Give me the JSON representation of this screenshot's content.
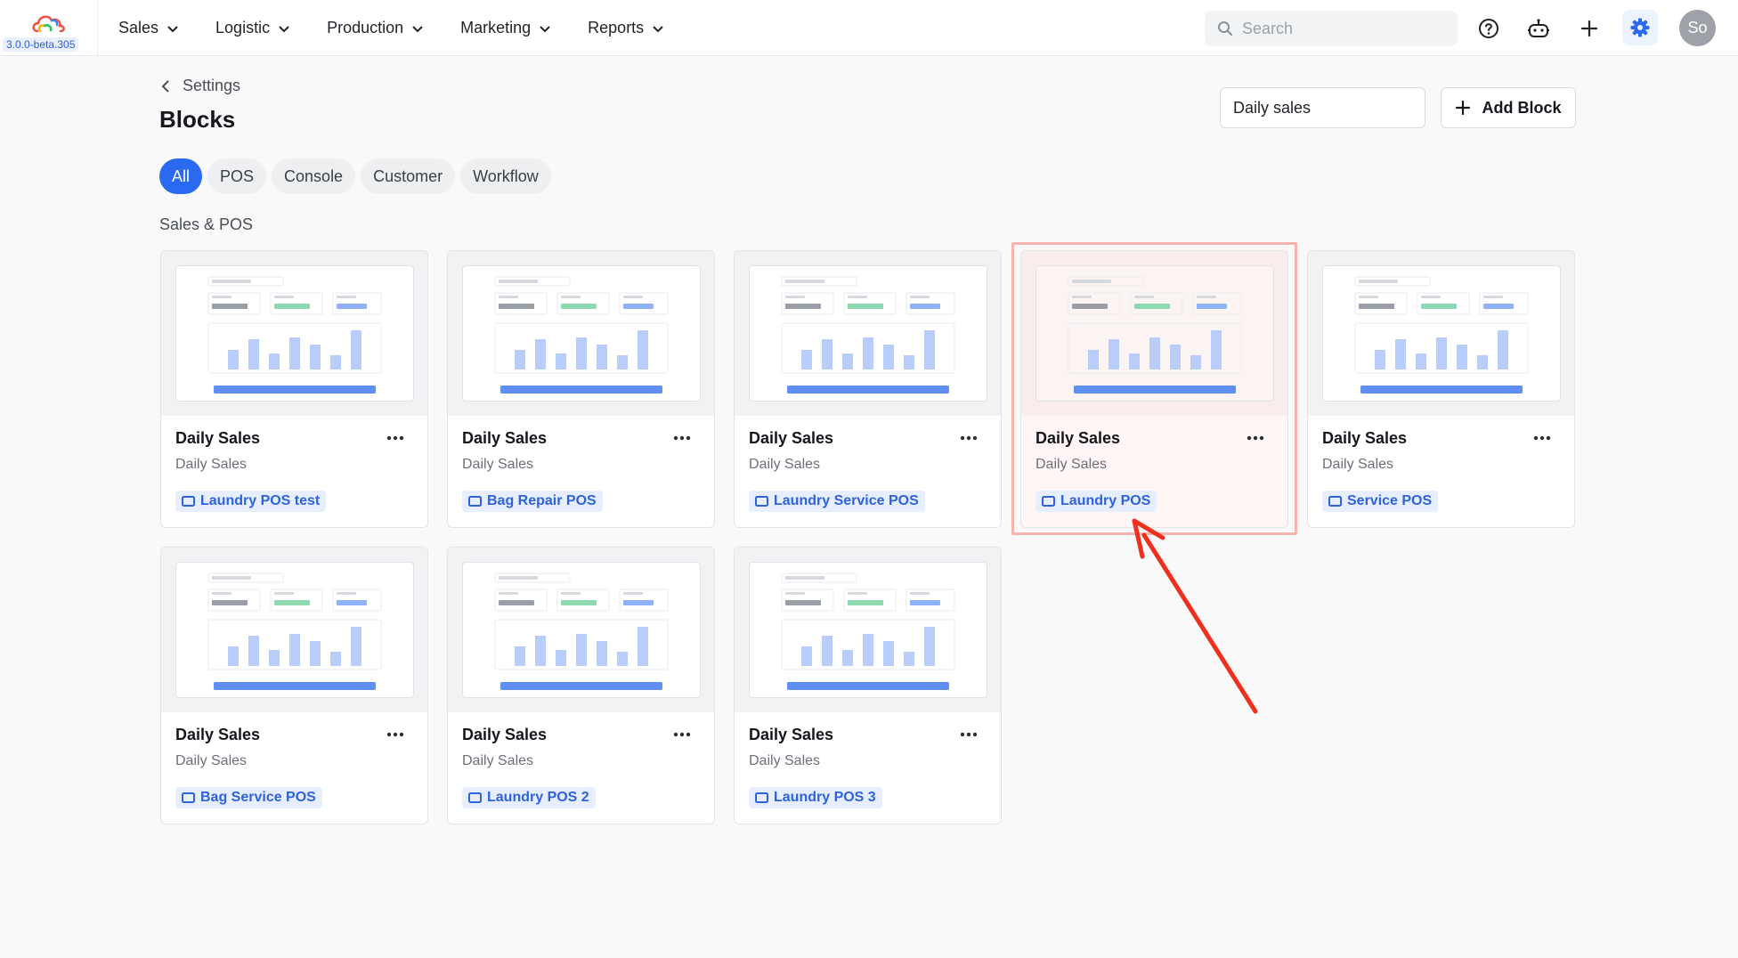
{
  "app": {
    "version": "3.0.0-beta.305"
  },
  "nav": {
    "items": [
      {
        "label": "Sales"
      },
      {
        "label": "Logistic"
      },
      {
        "label": "Production"
      },
      {
        "label": "Marketing"
      },
      {
        "label": "Reports"
      }
    ],
    "search_placeholder": "Search",
    "avatar_initials": "So"
  },
  "header": {
    "breadcrumb": "Settings",
    "title": "Blocks",
    "name_input_value": "Daily sales",
    "add_button_label": "Add Block"
  },
  "tabs": [
    {
      "label": "All",
      "active": true
    },
    {
      "label": "POS",
      "active": false
    },
    {
      "label": "Console",
      "active": false
    },
    {
      "label": "Customer",
      "active": false
    },
    {
      "label": "Workflow",
      "active": false
    }
  ],
  "section": {
    "title": "Sales & POS"
  },
  "cards": [
    {
      "title": "Daily Sales",
      "subtitle": "Daily Sales",
      "tag": "Laundry POS test",
      "selected": false
    },
    {
      "title": "Daily Sales",
      "subtitle": "Daily Sales",
      "tag": "Bag Repair POS",
      "selected": false
    },
    {
      "title": "Daily Sales",
      "subtitle": "Daily Sales",
      "tag": "Laundry Service POS",
      "selected": false
    },
    {
      "title": "Daily Sales",
      "subtitle": "Daily Sales",
      "tag": "Laundry POS",
      "selected": true
    },
    {
      "title": "Daily Sales",
      "subtitle": "Daily Sales",
      "tag": "Service POS",
      "selected": false
    },
    {
      "title": "Daily Sales",
      "subtitle": "Daily Sales",
      "tag": "Bag Service POS",
      "selected": false
    },
    {
      "title": "Daily Sales",
      "subtitle": "Daily Sales",
      "tag": "Laundry POS 2",
      "selected": false
    },
    {
      "title": "Daily Sales",
      "subtitle": "Daily Sales",
      "tag": "Laundry POS 3",
      "selected": false
    }
  ],
  "colors": {
    "accent": "#2a6af0",
    "tag_text": "#2f63d9",
    "highlight_border": "#f7b3ad",
    "annotation_arrow": "#f0301e"
  },
  "icons": {
    "logo": "cloud-logo-icon",
    "search": "search-icon",
    "help": "help-circle-icon",
    "bot": "robot-icon",
    "add": "plus-icon",
    "settings": "gear-icon",
    "more": "more-dots-icon",
    "tag": "pos-device-icon"
  }
}
